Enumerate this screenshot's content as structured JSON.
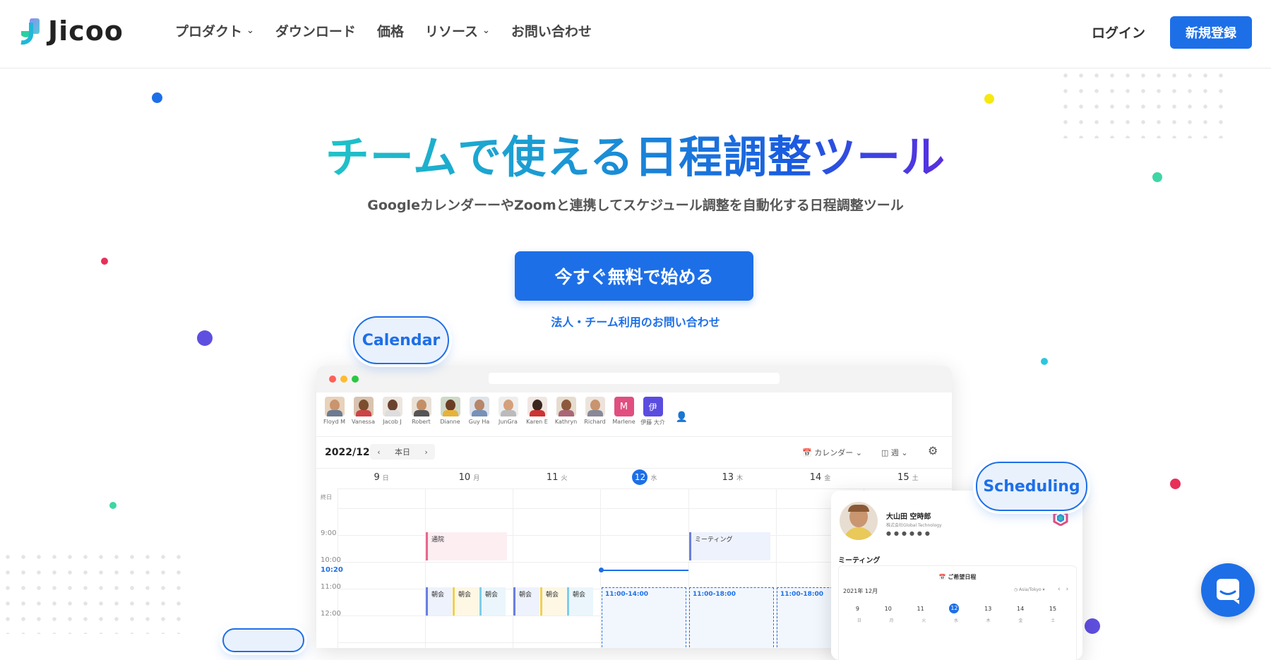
{
  "header": {
    "logo_text": "Jicoo",
    "nav": [
      {
        "label": "プロダクト",
        "has_dropdown": true
      },
      {
        "label": "ダウンロード",
        "has_dropdown": false
      },
      {
        "label": "価格",
        "has_dropdown": false
      },
      {
        "label": "リソース",
        "has_dropdown": true
      },
      {
        "label": "お問い合わせ",
        "has_dropdown": false
      }
    ],
    "login_label": "ログイン",
    "signup_label": "新規登録"
  },
  "hero": {
    "title": "チームで使える日程調整ツール",
    "subtitle": "GoogleカレンダーーやZoomと連携してスケジュール調整を自動化する日程調整ツール",
    "cta_label": "今すぐ無料で始める",
    "contact_link": "法人・チーム利用のお問い合わせ"
  },
  "pills": {
    "calendar": "Calendar",
    "scheduling": "Scheduling"
  },
  "app_preview": {
    "members": [
      "Floyd M",
      "Vanessa",
      "Jacob J",
      "Robert",
      "Dianne",
      "Guy Ha",
      "JunGra",
      "Karen E",
      "Kathryn",
      "Richard",
      "Marlene",
      "伊藤 大介"
    ],
    "member_initials": {
      "marlene": "M",
      "ito": "伊"
    },
    "year_month": "2022/12",
    "today_label": "本日",
    "calendar_select": "カレンダー",
    "view_select": "週",
    "days": [
      {
        "num": "9",
        "dow": "日"
      },
      {
        "num": "10",
        "dow": "月"
      },
      {
        "num": "11",
        "dow": "火"
      },
      {
        "num": "12",
        "dow": "水"
      },
      {
        "num": "13",
        "dow": "木"
      },
      {
        "num": "14",
        "dow": "金"
      },
      {
        "num": "15",
        "dow": "土"
      }
    ],
    "allday_label": "終日",
    "times": [
      "9:00",
      "10:00",
      "10:20",
      "11:00",
      "12:00"
    ],
    "events": {
      "hospital": "通院",
      "meeting": "ミーティング",
      "morning": "朝会",
      "slot": "11:00-14:00",
      "slot2": "11:00-18:00"
    }
  },
  "profile_card": {
    "name": "大山田 空時郎",
    "company": "株式会社Global Technology",
    "event_title": "ミーティング",
    "section_title": "ご希望日程",
    "month": "2021年 12月",
    "timezone": "Asia/Tokyo",
    "dates": [
      "9",
      "10",
      "11",
      "12",
      "13",
      "14",
      "15"
    ],
    "dows": [
      "日",
      "月",
      "火",
      "水",
      "木",
      "金",
      "土"
    ]
  },
  "colors": {
    "primary": "#1d6fe8",
    "title_gradient_start": "#1fc3c8",
    "title_gradient_end": "#5a2ee0"
  }
}
